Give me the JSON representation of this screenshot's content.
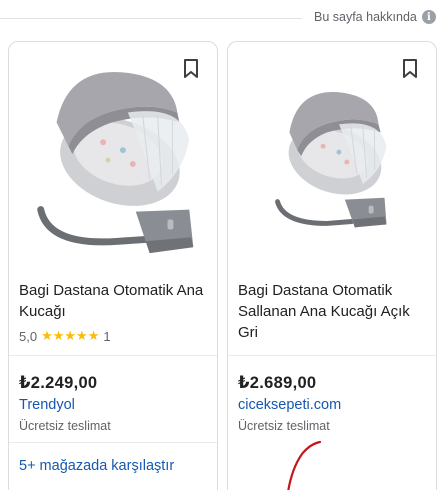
{
  "header": {
    "about_label": "Bu sayfa hakkında",
    "info_glyph": "i"
  },
  "products": [
    {
      "title": "Bagi Dastana Otomatik Ana Kucağı",
      "rating_value": "5,0",
      "stars": "★★★★★",
      "review_count": "1",
      "price": "₺2.249,00",
      "merchant": "Trendyol",
      "shipping": "Ücretsiz teslimat",
      "compare": "5+ mağazada karşılaştır",
      "image_icon": "baby-swing-image"
    },
    {
      "title": "Bagi Dastana Otomatik Sallanan Ana Kucağı Açık Gri",
      "price": "₺2.689,00",
      "merchant": "ciceksepeti.com",
      "shipping": "Ücretsiz teslimat",
      "image_icon": "baby-swing-image"
    }
  ],
  "colors": {
    "link": "#1558b0",
    "star": "#fbbc04",
    "annotation": "#c4161c"
  }
}
